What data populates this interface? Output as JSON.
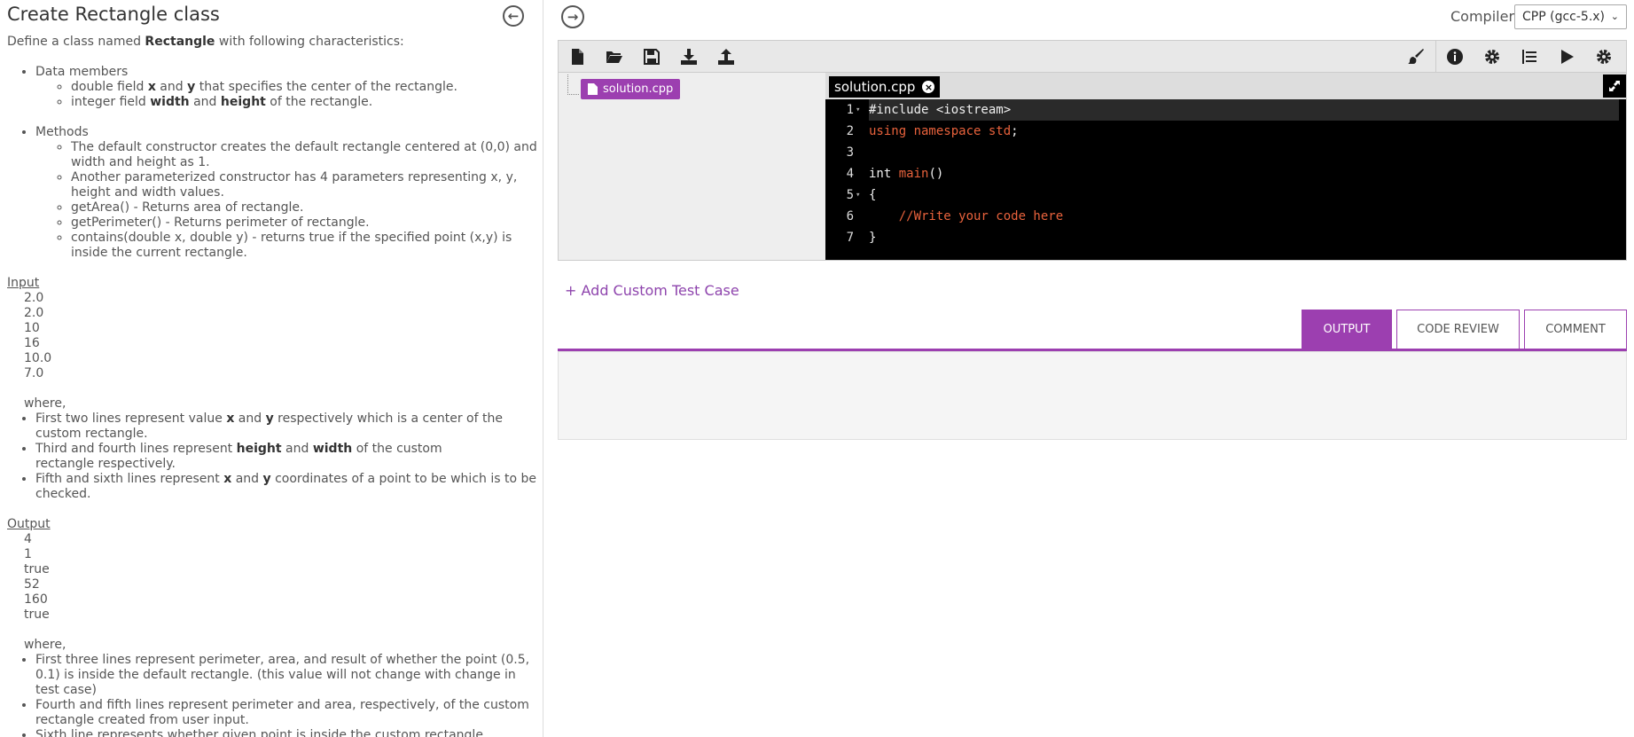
{
  "problem": {
    "title": "Create Rectangle class",
    "intro_pre": "Define a class named ",
    "intro_bold": "Rectangle",
    "intro_post": " with following characteristics:",
    "data_members_label": "Data members",
    "dm1_a": "double field ",
    "dm1_x": "x",
    "dm1_b": " and ",
    "dm1_y": "y",
    "dm1_c": " that specifies the center of the rectangle.",
    "dm2_a": "integer field ",
    "dm2_w": "width",
    "dm2_b": " and ",
    "dm2_h": "height",
    "dm2_c": " of the rectangle.",
    "methods_label": "Methods",
    "methods": [
      "The default constructor creates the default rectangle centered at (0,0) and width and height as 1.",
      "Another parameterized constructor has 4 parameters representing x, y, height and width values.",
      "getArea() - Returns area of rectangle.",
      "getPerimeter() - Returns perimeter of rectangle.",
      "contains(double x, double y) - returns true if the specified point (x,y) is inside the current rectangle."
    ],
    "input_label": "Input",
    "input_values": [
      "2.0",
      "2.0",
      "10",
      "16",
      "10.0",
      "7.0"
    ],
    "where_label": "where,",
    "in1_a": "First two lines represent value ",
    "in1_x": "x",
    "in1_b": " and ",
    "in1_y": "y",
    "in1_c": " respectively which is a center of the custom rectangle.",
    "in2_a": "Third and fourth lines represent ",
    "in2_h": "height",
    "in2_b": " and ",
    "in2_w": "width",
    "in2_c": " of the custom",
    "in2_d": "rectangle respectively.",
    "in3_a": "Fifth and sixth lines represent ",
    "in3_x": "x",
    "in3_b": " and ",
    "in3_y": "y",
    "in3_c": " coordinates of a point to be which is to be checked.",
    "output_label": "Output",
    "output_values": [
      "4",
      "1",
      "true",
      "52",
      "160",
      "true"
    ],
    "output_notes": [
      "First three lines represent perimeter, area, and result of whether the point (0.5, 0.1) is inside the default rectangle. (this value will not change with change in test case)",
      "Fourth and fifth lines represent perimeter and area, respectively, of the custom rectangle created from user input.",
      "Sixth line represents whether given point is inside the custom rectangle."
    ]
  },
  "compiler": {
    "label": "Compiler:",
    "selected": "CPP (gcc-5.x)"
  },
  "toolbar": {
    "left": [
      "new-file-icon",
      "open-folder-icon",
      "save-icon",
      "download-icon",
      "upload-icon"
    ],
    "right": [
      "brush-icon",
      "info-icon",
      "settings-gear-icon",
      "indent-icon",
      "run-icon",
      "run-settings-icon"
    ]
  },
  "file_tree": {
    "file": "solution.cpp"
  },
  "editor": {
    "tab_name": "solution.cpp",
    "lines": [
      {
        "n": "1",
        "fold": true
      },
      {
        "n": "2",
        "fold": false
      },
      {
        "n": "3",
        "fold": false
      },
      {
        "n": "4",
        "fold": false
      },
      {
        "n": "5",
        "fold": true
      },
      {
        "n": "6",
        "fold": false
      },
      {
        "n": "7",
        "fold": false
      }
    ],
    "code": {
      "l1": "#include <iostream>",
      "l2_kw": "using namespace",
      "l2_std": " std",
      "l2_end": ";",
      "l4_a": "int ",
      "l4_fn": "main",
      "l4_b": "()",
      "l5": "{",
      "l6_indent": "    ",
      "l6": "//Write your code here",
      "l7": "}"
    }
  },
  "add_test_label": "+ Add Custom Test Case",
  "result_tabs": {
    "output": "OUTPUT",
    "review": "CODE REVIEW",
    "comment": "COMMENT"
  }
}
